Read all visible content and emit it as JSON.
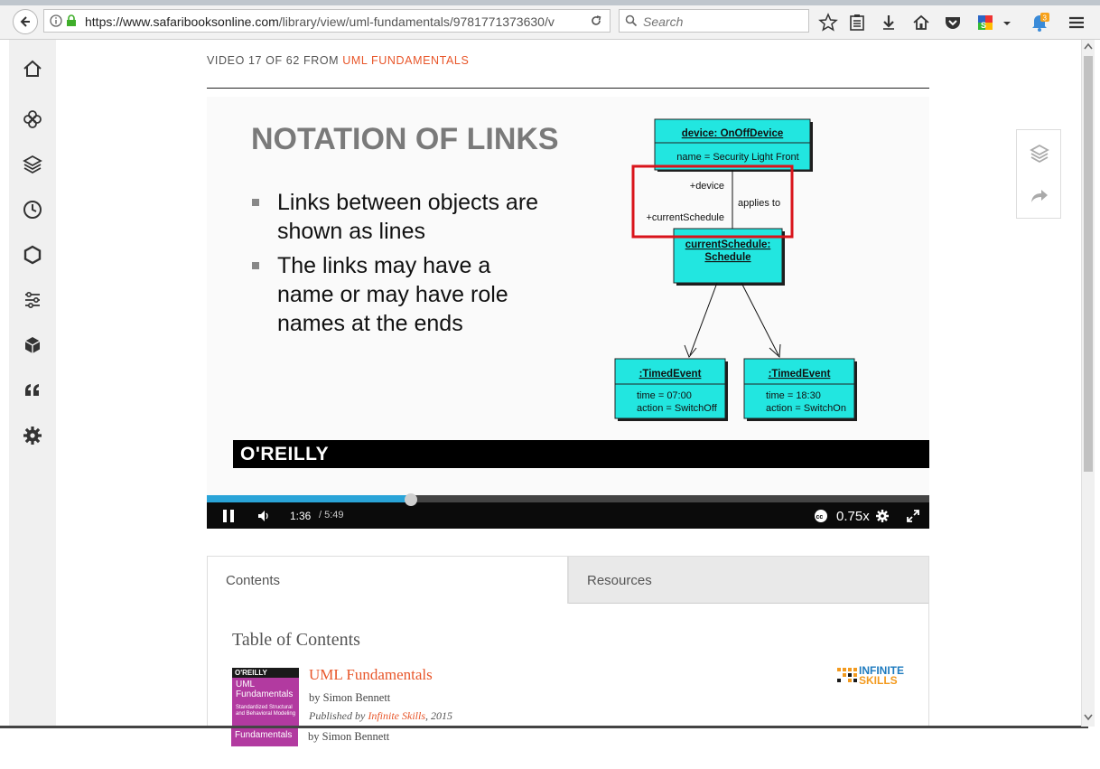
{
  "browser": {
    "url_host": "https://www.safaribooksonline.com",
    "url_path": "/library/view/uml-fundamentals/9781771373630/v",
    "search_placeholder": "Search",
    "notification_count": "3"
  },
  "page": {
    "breadcrumb_prefix": "VIDEO 17 OF 62 FROM",
    "breadcrumb_link": "UML FUNDAMENTALS"
  },
  "slide": {
    "title": "NOTATION OF LINKS",
    "bullets": [
      "Links between objects are shown as lines",
      "The links may have a name or may have role names at the ends"
    ],
    "brand": "O'REILLY",
    "diagram": {
      "device_title": "device: OnOffDevice",
      "device_attr": "name = Security Light Front",
      "role_device": "+device",
      "role_schedule": "+currentSchedule",
      "link_name": "applies to",
      "schedule_title_1": "currentSchedule:",
      "schedule_title_2": "Schedule",
      "event1_title": ":TimedEvent",
      "event1_attr1": "time = 07:00",
      "event1_attr2": "action = SwitchOff",
      "event2_title": ":TimedEvent",
      "event2_attr1": "time = 18:30",
      "event2_attr2": "action = SwitchOn"
    }
  },
  "player": {
    "current_time": "1:36",
    "total_time": "/ 5:49",
    "speed": "0.75x",
    "progress": 0.283
  },
  "tabs": {
    "contents": "Contents",
    "resources": "Resources"
  },
  "toc": {
    "heading": "Table of Contents",
    "book_title": "UML Fundamentals",
    "author": "by Simon Bennett",
    "published_prefix": "Published by",
    "publisher": "Infinite Skills",
    "year": ", 2015",
    "cover_brand": "O'REILLY",
    "cover_title": "UML Fundamentals",
    "cover_subtitle": "Standardized Structural and Behavioral Modeling",
    "publisher_logo_line1": "INFINITE",
    "publisher_logo_line2": "SKILLS",
    "fragment_cover_title": "Fundamentals",
    "fragment_author": "by Simon Bennett"
  },
  "colors": {
    "accent": "#e8562a",
    "uml_box": "#22e6e0",
    "highlight": "#d9141b",
    "progress": "#2aa4d8"
  }
}
